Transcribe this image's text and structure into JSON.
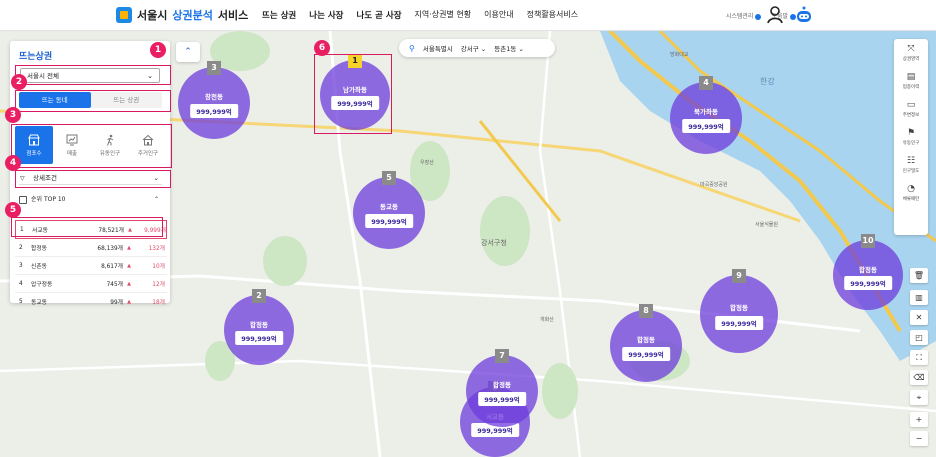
{
  "header": {
    "logo": {
      "prefix": "서울시 ",
      "highlight": "상권분석",
      "suffix": "서비스"
    },
    "nav": [
      "뜨는 상권",
      "나는 사장",
      "나도 곧 사장",
      "지역·상권별 현황",
      "이용안내",
      "정책활용서비스"
    ],
    "util": [
      "시스템관리",
      "도움말"
    ]
  },
  "panel": {
    "title": "뜨는상권",
    "region": "서울시 전체",
    "toggle": {
      "active": "뜨는 동네",
      "inactive": "뜨는 상권"
    },
    "tabs": [
      "점포수",
      "매출",
      "유동인구",
      "주거인구"
    ],
    "detail": "상세조건",
    "rank_title": "순위 TOP 10",
    "ranks": [
      {
        "no": "1",
        "name": "서교동",
        "count": "78,521개",
        "change": "9,999개"
      },
      {
        "no": "2",
        "name": "합정동",
        "count": "68,139개",
        "change": "132개"
      },
      {
        "no": "3",
        "name": "신촌동",
        "count": "8,617개",
        "change": "10개"
      },
      {
        "no": "4",
        "name": "압구정동",
        "count": "745개",
        "change": "12개"
      },
      {
        "no": "5",
        "name": "동교동",
        "count": "99개",
        "change": "18개"
      }
    ]
  },
  "callouts": [
    "1",
    "2",
    "3",
    "4",
    "5",
    "6"
  ],
  "location": {
    "city": "서울특별시",
    "district": "강서구",
    "dong": "등촌1동"
  },
  "bubbles": [
    {
      "rank": "1",
      "name": "남가좌동",
      "value": "999,999억"
    },
    {
      "rank": "2",
      "name": "합정동",
      "value": "999,999억"
    },
    {
      "rank": "3",
      "name": "창천동",
      "value": "999,999억"
    },
    {
      "rank": "4",
      "name": "북가좌동",
      "value": "999,999억"
    },
    {
      "rank": "5",
      "name": "동교동",
      "value": "999,999억"
    },
    {
      "rank": "6",
      "name": "서교동",
      "value": "999,999억"
    },
    {
      "rank": "7",
      "name": "합정동",
      "value": "999,999억"
    },
    {
      "rank": "8",
      "name": "합정동",
      "value": "999,999억"
    },
    {
      "rank": "9",
      "name": "합정동",
      "value": "999,999억"
    },
    {
      "rank": "10",
      "name": "합정동",
      "value": "999,999억"
    }
  ],
  "rtools": [
    "상권영역",
    "업종이력",
    "주변정보",
    "유동인구",
    "인구밀도",
    "체류패턴"
  ],
  "map_labels": [
    "강서구청",
    "우장산",
    "마곡중앙공원",
    "서울식물원",
    "한강",
    "개화산",
    "방화대교"
  ],
  "colors": {
    "primary": "#1a73e8",
    "bubble": "#6e3cdc",
    "callout": "#e91e63",
    "rank_badge_top": "#f5d32a",
    "rank_badge": "#8a8a8a"
  },
  "icons": [
    "store-icon",
    "chart-icon",
    "walk-icon",
    "house-icon",
    "filter-icon",
    "list-icon",
    "pin-icon",
    "user-icon",
    "robot-icon"
  ]
}
